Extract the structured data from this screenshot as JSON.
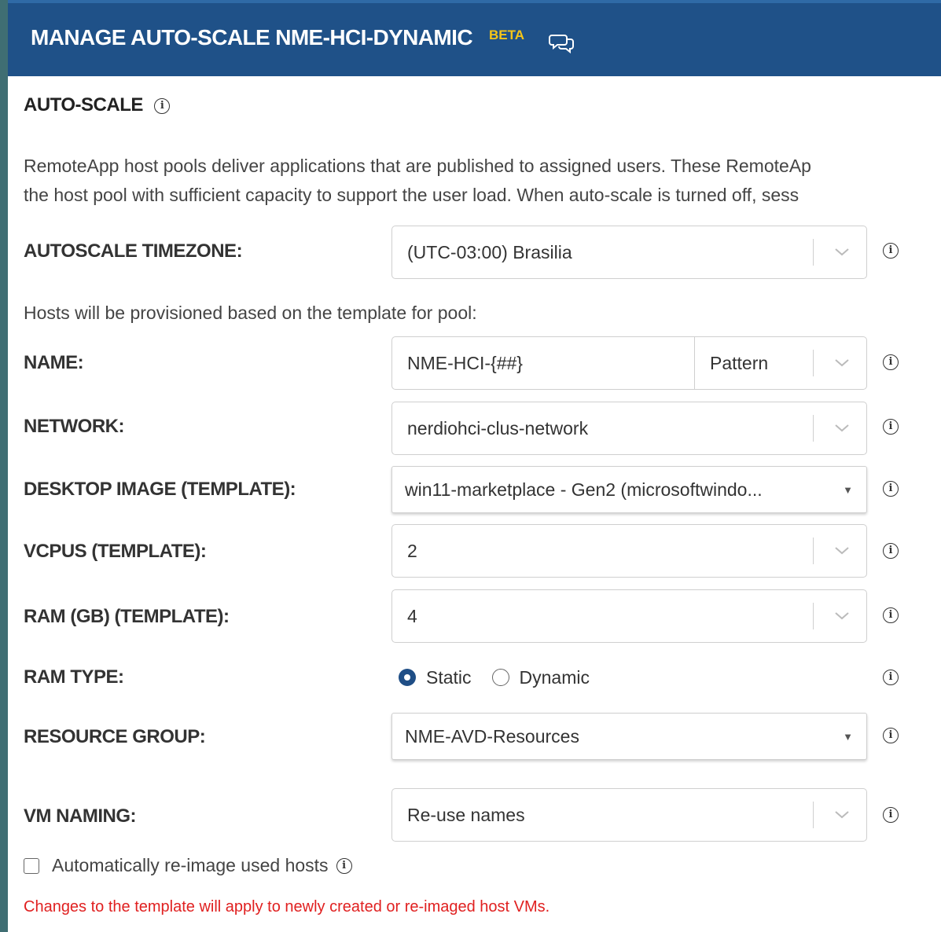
{
  "header": {
    "title": "MANAGE AUTO-SCALE NME-HCI-DYNAMIC",
    "badge": "BETA",
    "chat_icon": "chat-bubbles-icon",
    "background": "#1f5188",
    "badge_color": "#f5c518"
  },
  "section": {
    "title": "AUTO-SCALE",
    "description_line1": "RemoteApp host pools deliver applications that are published to assigned users. These RemoteAp",
    "description_line2": "the host pool with sufficient capacity to support the user load. When auto-scale is turned off, sess"
  },
  "timezone": {
    "label": "AUTOSCALE TIMEZONE:",
    "value": "(UTC-03:00) Brasilia"
  },
  "template_intro": "Hosts will be provisioned based on the template for pool:",
  "name": {
    "label": "NAME:",
    "value": "NME-HCI-{##}",
    "mode": "Pattern"
  },
  "network": {
    "label": "NETWORK:",
    "value": "nerdiohci-clus-network"
  },
  "desktop_image": {
    "label": "DESKTOP IMAGE (TEMPLATE):",
    "value": "win11-marketplace - Gen2 (microsoftwindo..."
  },
  "vcpus": {
    "label": "VCPUS (TEMPLATE):",
    "value": "2"
  },
  "ram": {
    "label": "RAM (GB) (TEMPLATE):",
    "value": "4"
  },
  "ram_type": {
    "label": "RAM TYPE:",
    "options": [
      "Static",
      "Dynamic"
    ],
    "selected": "Static"
  },
  "resource_group": {
    "label": "RESOURCE GROUP:",
    "value": "NME-AVD-Resources"
  },
  "vm_naming": {
    "label": "VM NAMING:",
    "value": "Re-use names"
  },
  "reimage": {
    "label": "Automatically re-image used hosts",
    "checked": false
  },
  "note": {
    "text": "Changes to the template will apply to newly created or re-imaged host VMs.",
    "color": "#e02020"
  }
}
